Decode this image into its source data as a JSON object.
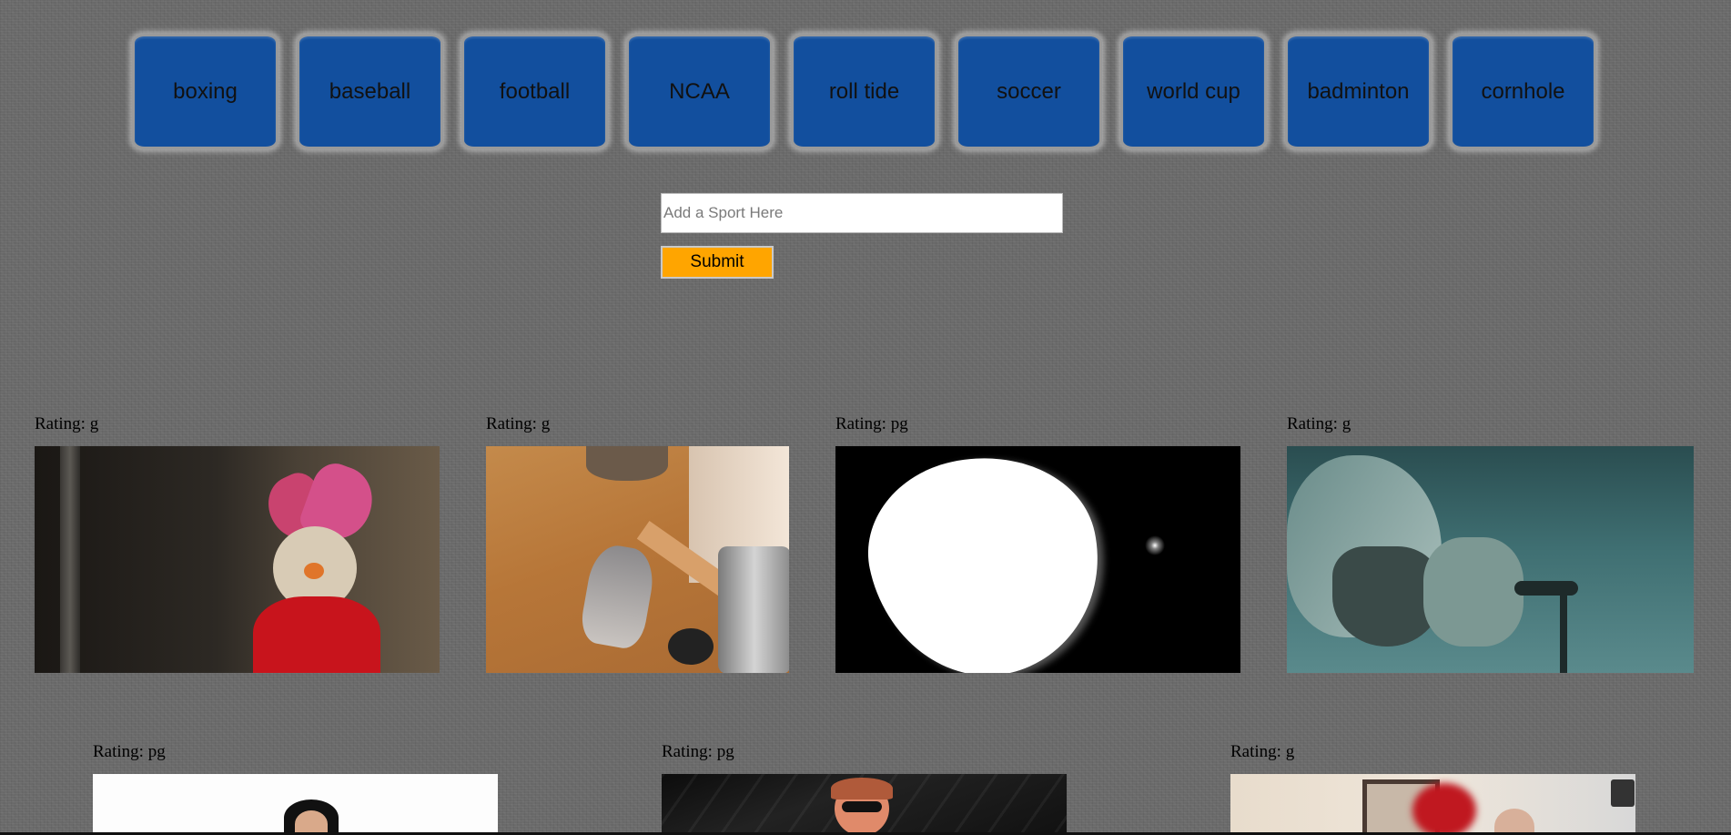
{
  "sports": [
    {
      "label": "boxing"
    },
    {
      "label": "baseball"
    },
    {
      "label": "football"
    },
    {
      "label": "NCAA"
    },
    {
      "label": "roll tide"
    },
    {
      "label": "soccer"
    },
    {
      "label": "world cup"
    },
    {
      "label": "badminton"
    },
    {
      "label": "cornhole"
    }
  ],
  "form": {
    "input_value": "",
    "input_placeholder": "Add a Sport Here",
    "submit_label": "Submit"
  },
  "gifs": [
    {
      "rating": "Rating: g"
    },
    {
      "rating": "Rating: g"
    },
    {
      "rating": "Rating: pg"
    },
    {
      "rating": "Rating: g"
    },
    {
      "rating": "Rating: pg"
    },
    {
      "rating": "Rating: pg"
    },
    {
      "rating": "Rating: g"
    }
  ],
  "colors": {
    "button_blue": "#124f9e",
    "submit_orange": "#ffa500",
    "background": "#6a6a6a"
  }
}
